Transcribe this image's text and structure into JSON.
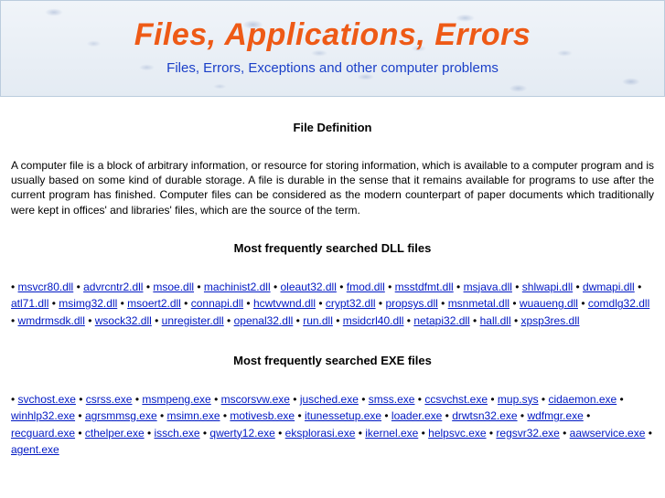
{
  "header": {
    "title": "Files, Applications, Errors",
    "subtitle": "Files, Errors, Exceptions and other computer problems"
  },
  "sections": {
    "definition": {
      "heading": "File Definition",
      "body": "A computer file is a block of arbitrary information, or resource for storing information, which is available to a computer program and is usually based on some kind of durable storage. A file is durable in the sense that it remains available for programs to use after the current program has finished. Computer files can be considered as the modern counterpart of paper documents which traditionally were kept in offices' and libraries' files, which are the source of the term."
    },
    "dll": {
      "heading": "Most frequently searched DLL files",
      "items": [
        "msvcr80.dll",
        "advrcntr2.dll",
        "msoe.dll",
        "machinist2.dll",
        "oleaut32.dll",
        "fmod.dll",
        "msstdfmt.dll",
        "msjava.dll",
        "shlwapi.dll",
        "dwmapi.dll",
        "atl71.dll",
        "msimg32.dll",
        "msoert2.dll",
        "connapi.dll",
        "hcwtvwnd.dll",
        "crypt32.dll",
        "propsys.dll",
        "msnmetal.dll",
        "wuaueng.dll",
        "comdlg32.dll",
        "wmdrmsdk.dll",
        "wsock32.dll",
        "unregister.dll",
        "openal32.dll",
        "run.dll",
        "msidcrl40.dll",
        "netapi32.dll",
        "hall.dll",
        "xpsp3res.dll"
      ]
    },
    "exe": {
      "heading": "Most frequently searched EXE files",
      "items": [
        "svchost.exe",
        "csrss.exe",
        "msmpeng.exe",
        "mscorsvw.exe",
        "jusched.exe",
        "smss.exe",
        "ccsvchst.exe",
        "mup.sys",
        "cidaemon.exe",
        "winhlp32.exe",
        "agrsmmsg.exe",
        "msimn.exe",
        "motivesb.exe",
        "itunessetup.exe",
        "loader.exe",
        "drwtsn32.exe",
        "wdfmgr.exe",
        "recguard.exe",
        "cthelper.exe",
        "issch.exe",
        "qwerty12.exe",
        "eksplorasi.exe",
        "ikernel.exe",
        "helpsvc.exe",
        "regsvr32.exe",
        "aawservice.exe",
        "agent.exe"
      ]
    }
  }
}
